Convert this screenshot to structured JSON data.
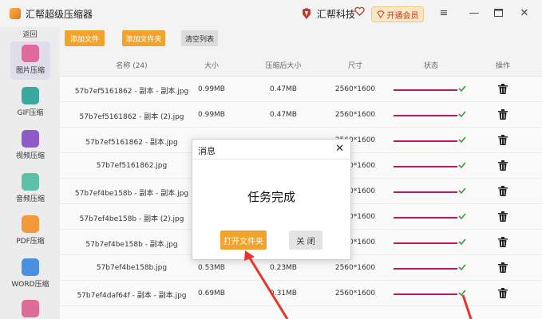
{
  "app": {
    "title": "汇帮超级压缩器",
    "brand": "汇帮科技",
    "vip_label": "开通会员"
  },
  "sidebar": {
    "back": "返回",
    "items": [
      {
        "label": "图片压缩",
        "color": "#e06a9a"
      },
      {
        "label": "GIF压缩",
        "color": "#3aa8a0"
      },
      {
        "label": "视频压缩",
        "color": "#8e5cc9"
      },
      {
        "label": "音频压缩",
        "color": "#5bc0a6"
      },
      {
        "label": "PDF压缩",
        "color": "#f29a3a"
      },
      {
        "label": "WORD压缩",
        "color": "#4a8fe0"
      },
      {
        "label": "",
        "color": "#e06a9a"
      }
    ]
  },
  "toolbar": {
    "add_file": "添加文件",
    "add_folder": "添加文件夹",
    "clear_list": "清空列表"
  },
  "table": {
    "headers": [
      "名称 (24)",
      "大小",
      "压缩后大小",
      "尺寸",
      "状态",
      "操作"
    ],
    "rows": [
      {
        "name": "57b7ef5161862 - 副本 - 副本.jpg",
        "size": "0.99MB",
        "after": "0.47MB",
        "dims": "2560*1600"
      },
      {
        "name": "57b7ef5161862 - 副本 (2).jpg",
        "size": "0.99MB",
        "after": "0.47MB",
        "dims": "2560*1600"
      },
      {
        "name": "57b7ef5161862 - 副本.jpg",
        "size": "",
        "after": "",
        "dims": "2560*1600"
      },
      {
        "name": "57b7ef5161862.jpg",
        "size": "",
        "after": "",
        "dims": "2560*1600"
      },
      {
        "name": "57b7ef4be158b - 副本 - 副本.jpg",
        "size": "",
        "after": "",
        "dims": "2560*1600"
      },
      {
        "name": "57b7ef4be158b - 副本 (2).jpg",
        "size": "",
        "after": "",
        "dims": "2560*1600"
      },
      {
        "name": "57b7ef4be158b - 副本.jpg",
        "size": "",
        "after": "",
        "dims": "2560*1600"
      },
      {
        "name": "57b7ef4be158b.jpg",
        "size": "0.53MB",
        "after": "0.23MB",
        "dims": "2560*1600"
      },
      {
        "name": "57b7ef4daf64f - 副本 - 副本.jpg",
        "size": "0.69MB",
        "after": "0.31MB",
        "dims": "2560*1600"
      }
    ]
  },
  "modal": {
    "title": "消息",
    "message": "任务完成",
    "open_folder": "打开文件夹",
    "close": "关 闭"
  },
  "colors": {
    "accent": "#f0a42b",
    "progress": "#c2185b",
    "check": "#3a9a3a",
    "arrow": "#e8342a"
  }
}
